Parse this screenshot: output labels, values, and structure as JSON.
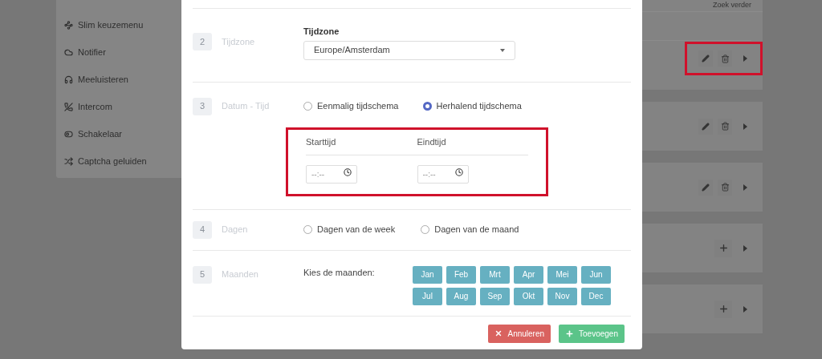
{
  "sidebar": {
    "items": [
      {
        "label": "Slim keuzemenu"
      },
      {
        "label": "Notifier"
      },
      {
        "label": "Meeluisteren"
      },
      {
        "label": "Intercom"
      },
      {
        "label": "Schakelaar"
      },
      {
        "label": "Captcha geluiden"
      }
    ]
  },
  "list": {
    "header_link": "Zoek verder",
    "rows": [
      {
        "kind": "edit",
        "highlighted": true
      },
      {
        "kind": "edit",
        "highlighted": false
      },
      {
        "kind": "edit",
        "highlighted": false
      },
      {
        "kind": "add",
        "highlighted": false
      },
      {
        "kind": "add",
        "highlighted": false
      }
    ]
  },
  "modal": {
    "steps": [
      {
        "kind": "timezone",
        "number": "2",
        "label": "Tijdzone",
        "field_label": "Tijdzone",
        "value": "Europe/Amsterdam"
      },
      {
        "kind": "datetime",
        "number": "3",
        "label": "Datum - Tijd",
        "options": [
          {
            "label": "Eenmalig tijdschema",
            "selected": false
          },
          {
            "label": "Herhalend tijdschema",
            "selected": true
          }
        ],
        "time_range": {
          "highlighted": true,
          "fields": [
            {
              "label": "Starttijd",
              "placeholder": "--:--"
            },
            {
              "label": "Eindtijd",
              "placeholder": "--:--"
            }
          ]
        }
      },
      {
        "kind": "days",
        "number": "4",
        "label": "Dagen",
        "options": [
          {
            "label": "Dagen van de week",
            "selected": false
          },
          {
            "label": "Dagen van de maand",
            "selected": false
          }
        ]
      },
      {
        "kind": "months",
        "number": "5",
        "label": "Maanden",
        "prompt": "Kies de maanden:",
        "months": [
          "Jan",
          "Feb",
          "Mrt",
          "Apr",
          "Mei",
          "Jun",
          "Jul",
          "Aug",
          "Sep",
          "Okt",
          "Nov",
          "Dec"
        ]
      }
    ],
    "buttons": [
      {
        "kind": "cancel",
        "label": "Annuleren"
      },
      {
        "kind": "add",
        "label": "Toevoegen"
      }
    ]
  }
}
